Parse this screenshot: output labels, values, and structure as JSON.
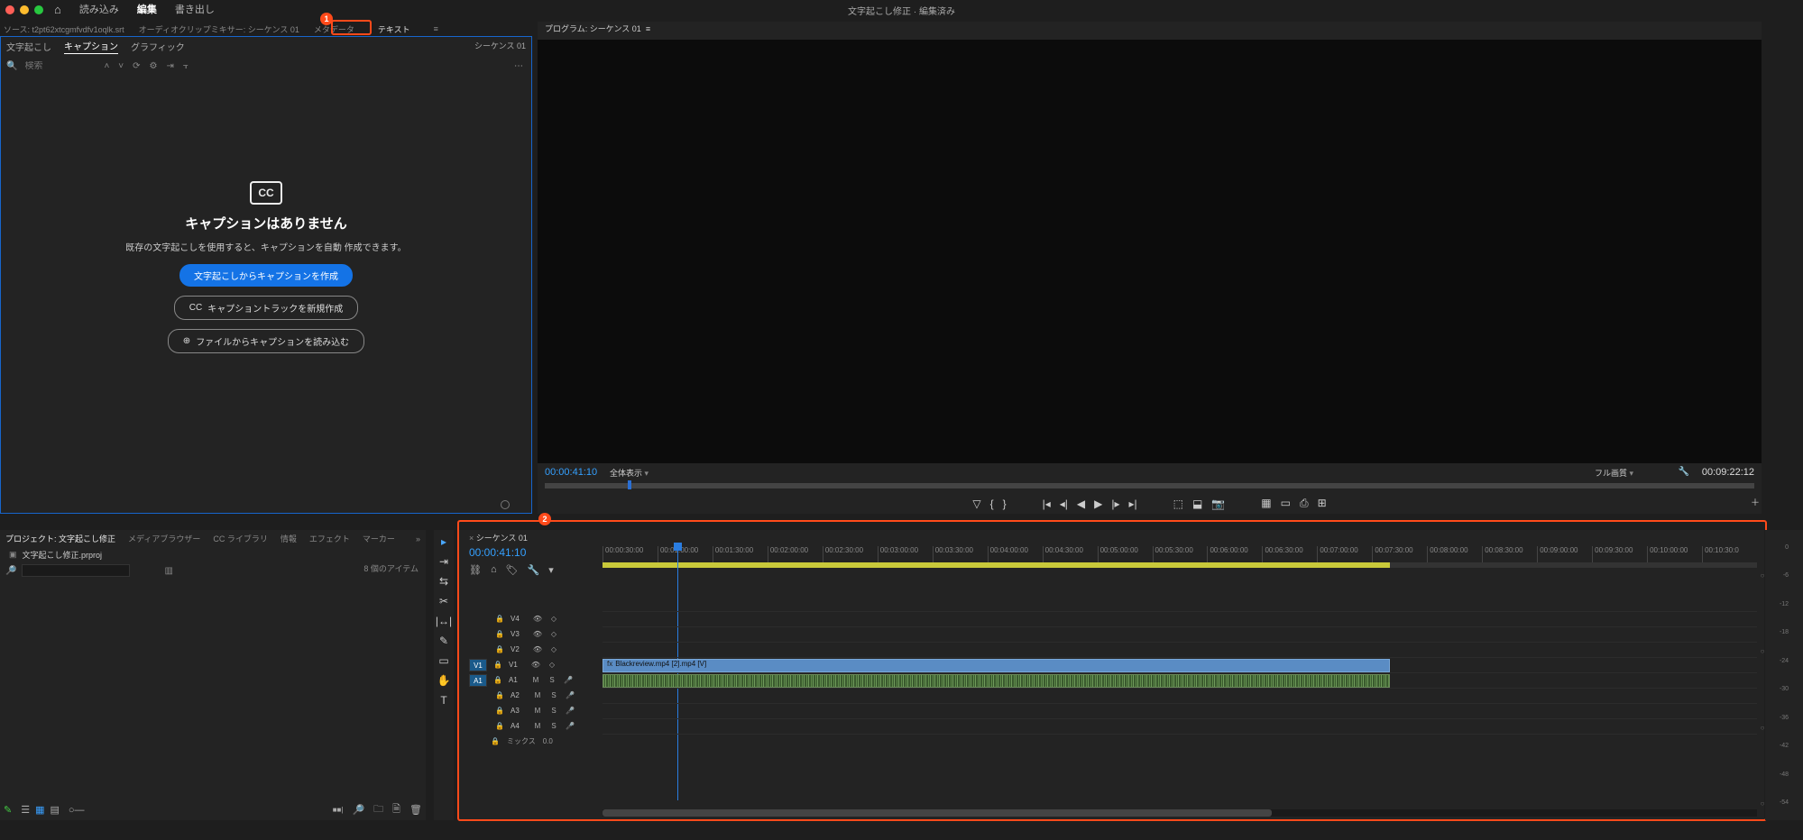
{
  "title": "文字起こし修正 · 編集済み",
  "top_menu": {
    "home": "⌂",
    "import": "読み込み",
    "edit": "編集",
    "export": "書き出し"
  },
  "source_tabs": {
    "source": "ソース: t2pt62xtcgmfvdfv1oqlk.srt",
    "mixer": "オーディオクリップミキサー: シーケンス 01",
    "metadata": "メタデータ",
    "text": "テキスト",
    "text_close": "≡"
  },
  "text_panel": {
    "tabs": {
      "transcript": "文字起こし",
      "caption": "キャプション",
      "graphics": "グラフィック"
    },
    "sequence_label": "シーケンス 01",
    "search_placeholder": "検索",
    "empty": {
      "heading": "キャプションはありません",
      "body": "既存の文字起こしを使用すると、キャプションを自動\n作成できます。",
      "btn_primary": "文字起こしからキャプションを作成",
      "btn_track": "キャプショントラックを新規作成",
      "btn_file": "ファイルからキャプションを読み込む"
    }
  },
  "program": {
    "tab": "プログラム: シーケンス 01",
    "tab_close": "≡",
    "tc_left": "00:00:41:10",
    "zoom": "全体表示",
    "quality": "フル画質",
    "tc_right": "00:09:22:12"
  },
  "project": {
    "tabs": {
      "project": "プロジェクト: 文字起こし修正",
      "media": "メディアブラウザー",
      "cc": "CC ライブラリ",
      "info": "情報",
      "effects": "エフェクト",
      "markers": "マーカー"
    },
    "bin": "文字起こし修正.prproj",
    "count": "8 個のアイテム"
  },
  "timeline": {
    "seq": "シーケンス 01",
    "tc": "00:00:41:10",
    "ruler": [
      "00:00:30:00",
      "00:01:00:00",
      "00:01:30:00",
      "00:02:00:00",
      "00:02:30:00",
      "00:03:00:00",
      "00:03:30:00",
      "00:04:00:00",
      "00:04:30:00",
      "00:05:00:00",
      "00:05:30:00",
      "00:06:00:00",
      "00:06:30:00",
      "00:07:00:00",
      "00:07:30:00",
      "00:08:00:00",
      "00:08:30:00",
      "00:09:00:00",
      "00:09:30:00",
      "00:10:00:00",
      "00:10:30:0"
    ],
    "video_tracks": [
      "V4",
      "V3",
      "V2",
      "V1"
    ],
    "audio_tracks": [
      "A1",
      "A2",
      "A3",
      "A4"
    ],
    "mix": "ミックス",
    "mix_val": "0.0",
    "clip_name": "Blackreview.mp4 [2].mp4 [V]",
    "src_v": "V1",
    "src_a": "A1"
  },
  "annot": {
    "n1": "1",
    "n2": "2"
  }
}
